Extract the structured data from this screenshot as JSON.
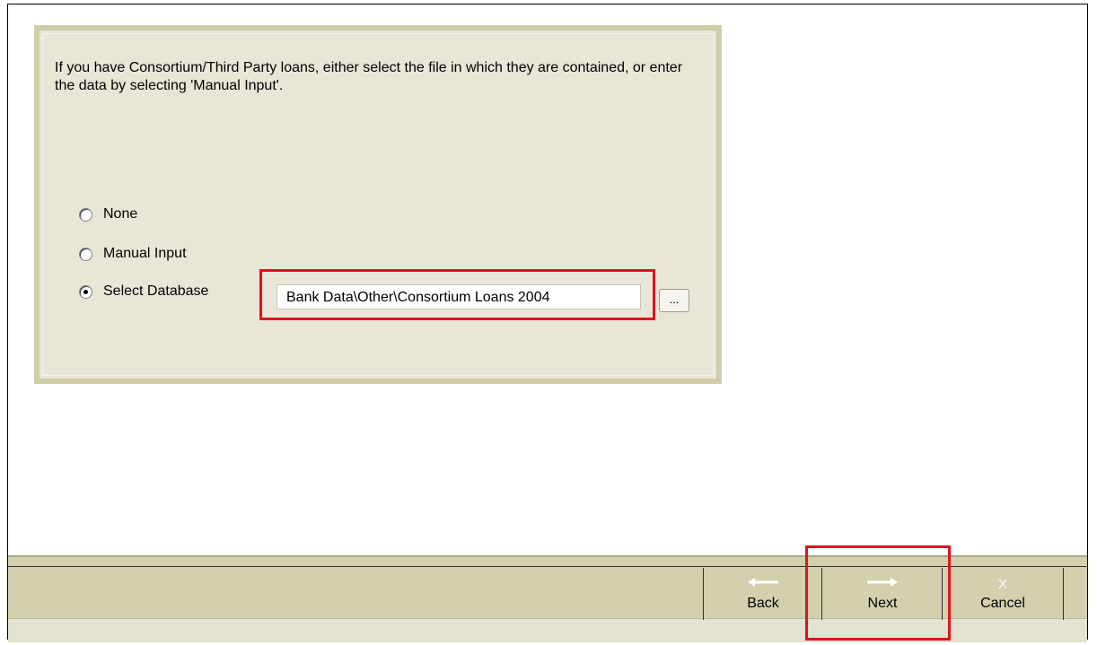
{
  "panel": {
    "instructions": "If you have Consortium/Third Party loans, either select the file in which they are contained, or enter the data by selecting 'Manual Input'.",
    "options": [
      {
        "label": "None",
        "selected": false
      },
      {
        "label": "Manual Input",
        "selected": false
      },
      {
        "label": "Select Database",
        "selected": true
      }
    ],
    "database_path": "Bank Data\\Other\\Consortium Loans 2004",
    "browse_label": "..."
  },
  "toolbar": {
    "back_label": "Back",
    "back_icon": "arrow-left-icon",
    "next_label": "Next",
    "next_icon": "arrow-right-icon",
    "cancel_label": "Cancel",
    "cancel_icon": "x-icon",
    "cancel_glyph": "X"
  },
  "colors": {
    "panel_bg": "#e8e6d7",
    "panel_border": "#cfcea9",
    "toolbar_bg": "#d2d0ad",
    "highlight": "#e2111e"
  }
}
